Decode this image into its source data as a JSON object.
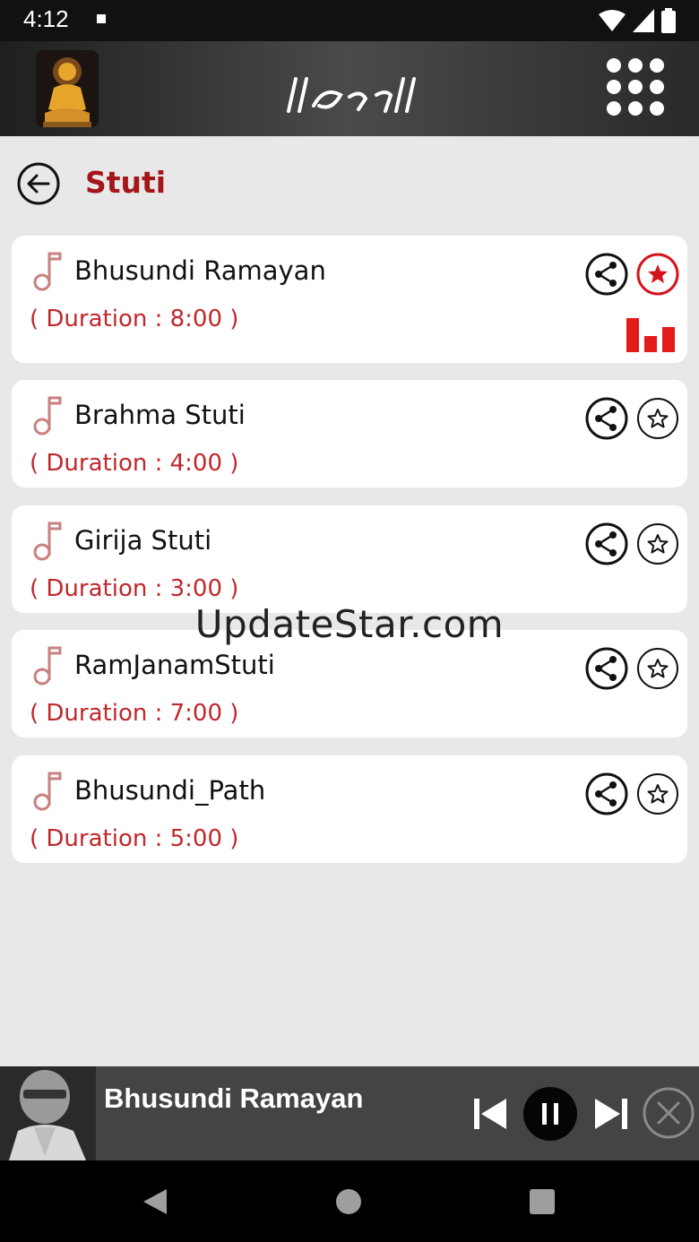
{
  "status_bar": {
    "time": "4:12"
  },
  "app_bar": {
    "title_icon": "app-title-script",
    "menu_icon": "grid-icon"
  },
  "header": {
    "title": "Stuti"
  },
  "tracks": [
    {
      "title": "Bhusundi Ramayan",
      "duration": "( Duration : 8:00 )",
      "favorite": true,
      "playing": true
    },
    {
      "title": "Brahma Stuti",
      "duration": "( Duration : 4:00 )",
      "favorite": false,
      "playing": false
    },
    {
      "title": "Girija Stuti",
      "duration": "( Duration : 3:00 )",
      "favorite": false,
      "playing": false
    },
    {
      "title": "RamJanamStuti",
      "duration": "( Duration : 7:00 )",
      "favorite": false,
      "playing": false
    },
    {
      "title": "Bhusundi_Path",
      "duration": "( Duration : 5:00 )",
      "favorite": false,
      "playing": false
    }
  ],
  "watermark": "UpdateStar.com",
  "player": {
    "title": "Bhusundi Ramayan"
  },
  "colors": {
    "accent": "#c0282c",
    "title_red": "#a4161a",
    "bar_red": "#e31b1b"
  }
}
